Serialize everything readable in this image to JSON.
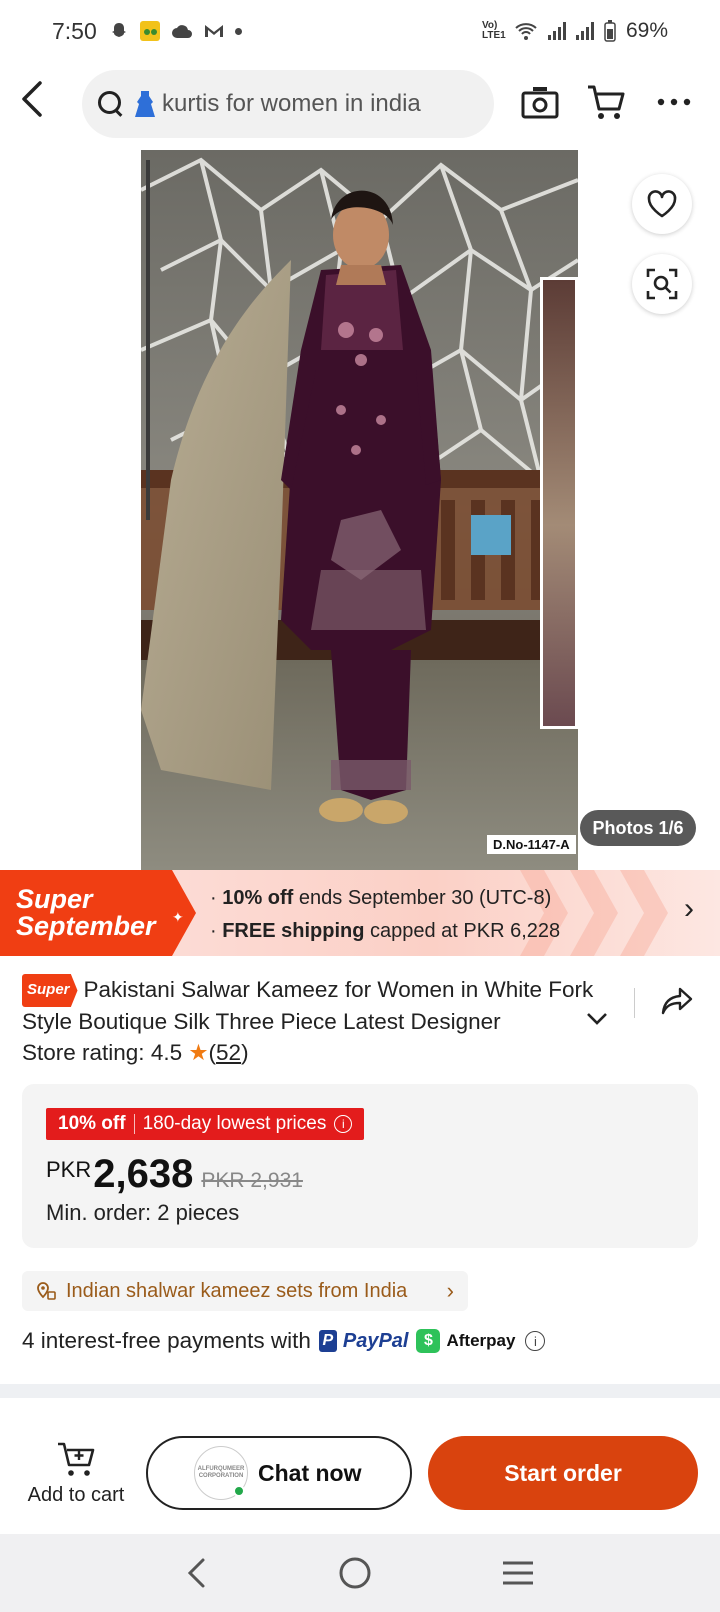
{
  "status_bar": {
    "time": "7:50",
    "network_label": "Vo) LTE1",
    "battery": "69%"
  },
  "header": {
    "search_text": "kurtis for women in india"
  },
  "product_image": {
    "photos_counter": "Photos 1/6",
    "design_no": "D.No-1147-A"
  },
  "promo": {
    "title_line1": "Super",
    "title_line2": "September",
    "line1_bold": "10% off",
    "line1_rest": "ends September 30 (UTC-8)",
    "line2_bold": "FREE shipping",
    "line2_rest": "capped at PKR 6,228"
  },
  "product": {
    "super_badge": "Super",
    "title": "Pakistani Salwar Kameez for Women in White Fork Style Boutique Silk Three Piece Latest Designer",
    "rating_label": "Store rating: 4.5",
    "rating_count": "52"
  },
  "price": {
    "discount_bold": "10% off",
    "discount_note": "180-day lowest prices",
    "currency": "PKR",
    "current": "2,638",
    "original": "PKR 2,931",
    "min_order": "Min. order: 2 pieces"
  },
  "origin": {
    "label": "Indian shalwar kameez sets from India"
  },
  "payments": {
    "text": "4 interest-free payments with",
    "paypal": "PayPal",
    "afterpay": "Afterpay"
  },
  "actions": {
    "add_to_cart": "Add to cart",
    "chat_now": "Chat now",
    "seller_logo_text": "ALFURQUMEER CORPORATION",
    "start_order": "Start order"
  },
  "colors": {
    "accent_orange": "#d9430e",
    "promo_red": "#f03e13",
    "discount_red": "#e31c1c",
    "origin_brown": "#9a5b1a"
  }
}
